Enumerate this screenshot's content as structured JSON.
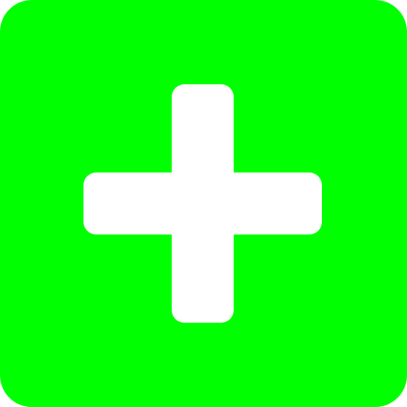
{
  "icon": {
    "name": "plus-icon",
    "background_color": "#00FF00",
    "glyph_color": "#FFFFFF"
  }
}
